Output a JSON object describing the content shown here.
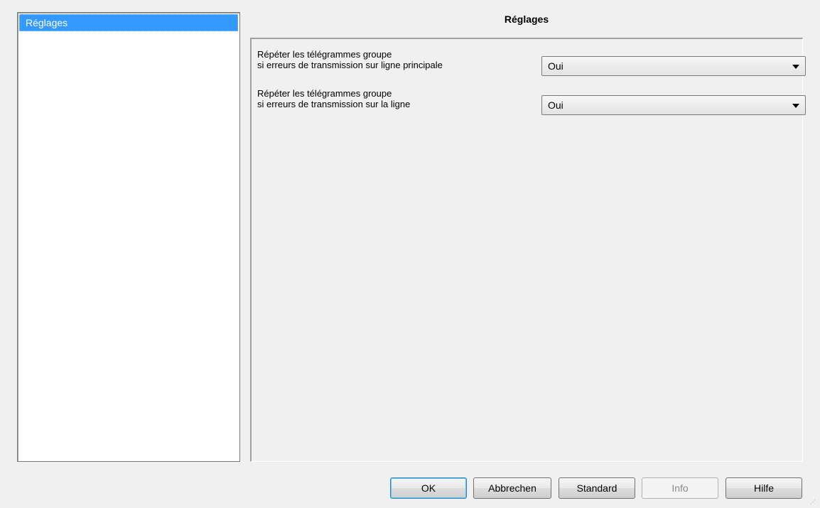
{
  "tree": {
    "items": [
      {
        "label": "Réglages",
        "selected": true
      }
    ]
  },
  "page": {
    "title": "Réglages"
  },
  "settings": [
    {
      "label": "Répéter les télégrammes groupe\nsi erreurs de transmission sur ligne principale",
      "value": "Oui"
    },
    {
      "label": "Répéter les télégrammes groupe\nsi erreurs de transmission sur la ligne",
      "value": "Oui"
    }
  ],
  "buttons": {
    "ok": "OK",
    "cancel": "Abbrechen",
    "standard": "Standard",
    "info": "Info",
    "help": "Hilfe"
  },
  "colors": {
    "selection": "#3399ff",
    "background": "#f0f0f0"
  }
}
